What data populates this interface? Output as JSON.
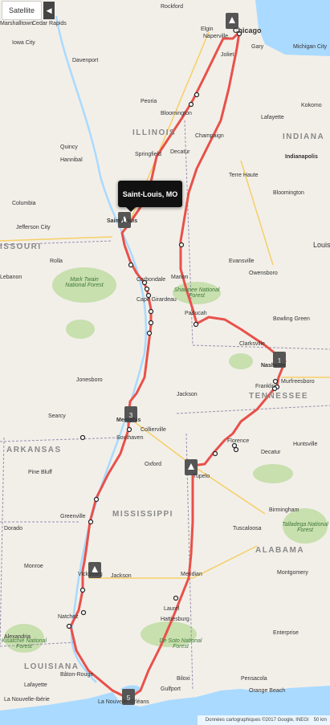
{
  "controls": {
    "satellite_label": "Satellite",
    "collapse_glyph": "◀"
  },
  "tooltip": {
    "title": "Saint-Louis, MO"
  },
  "footer": {
    "attribution": "Données cartographiques ©2017 Google, INEGI",
    "scale": "50 km"
  },
  "markers": [
    "",
    "",
    "1",
    "3",
    "",
    "",
    "",
    "4",
    "5"
  ],
  "labels": {
    "states": [
      "ILLINOIS",
      "INDIANA",
      "ISSOURI",
      "TENNESSEE",
      "ARKANSAS",
      "MISSISSIPPI",
      "ALABAMA",
      "LOUISIANA"
    ],
    "forests": [
      "Mark Twain National Forest",
      "Shawnee National Forest",
      "Kisatchie National Forest",
      "De Soto National Forest",
      "Talladega National Forest"
    ],
    "cities": [
      "Rockford",
      "Elgin",
      "Chicago",
      "Naperville",
      "Gary",
      "Michigan City",
      "Joliet",
      "Cedar Rapids",
      "Marshalltown",
      "Iowa City",
      "Davenport",
      "Peoria",
      "Bloomington",
      "Lafayette",
      "Kokomo",
      "Champaign",
      "Indianapolis",
      "Decatur",
      "Quincy",
      "Springfield",
      "Hannibal",
      "Terre Haute",
      "Columbia",
      "Saint-Louis",
      "Bloomington",
      "Jefferson City",
      "Evansville",
      "Louis",
      "Rolla",
      "Lebanon",
      "Carbondale",
      "Cape Girardeau",
      "Marion",
      "Owensboro",
      "Paducah",
      "Bowling Green",
      "Clarksville",
      "Nashville",
      "Murfreesboro",
      "Franklin",
      "Jonesboro",
      "Jackson",
      "Memphis",
      "Southaven",
      "Collierville",
      "Searcy",
      "Huntsville",
      "Decatur",
      "Florence",
      "Pine Bluff",
      "Tupelo",
      "Oxford",
      "Birmingham",
      "Greenville",
      "Tuscaloosa",
      "Dorado",
      "Monroe",
      "Vicksburg",
      "Jackson",
      "Meridian",
      "Montgomery",
      "Natchez",
      "Laurel",
      "Hattiesburg",
      "Alexandria",
      "Enterprise",
      "Lafayette",
      "Bâton-Rouge",
      "Biloxi",
      "Gulfport",
      "Pensacola",
      "La Nouvelle-Ibérie",
      "La Nouvelle-Orléans",
      "Orange Beach"
    ]
  },
  "colors": {
    "route": "#e8514a",
    "water": "#aadaff",
    "land": "#f2efe9",
    "forest": "#c8dfae",
    "state_border": "#9b8fae",
    "highway": "#f6cf65"
  }
}
